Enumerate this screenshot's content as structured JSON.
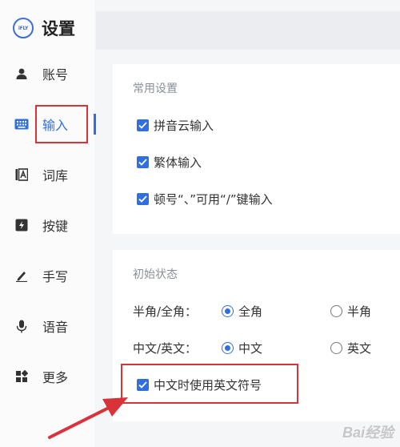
{
  "app": {
    "logo_text": "iFLY",
    "title": "设置"
  },
  "sidebar": {
    "items": [
      {
        "label": "账号",
        "icon": "user-icon"
      },
      {
        "label": "输入",
        "icon": "keyboard-icon",
        "active": true
      },
      {
        "label": "词库",
        "icon": "dictionary-icon"
      },
      {
        "label": "按键",
        "icon": "key-icon"
      },
      {
        "label": "手写",
        "icon": "handwriting-icon"
      },
      {
        "label": "语音",
        "icon": "microphone-icon"
      },
      {
        "label": "更多",
        "icon": "more-grid-icon"
      }
    ]
  },
  "common_settings": {
    "title": "常用设置",
    "options": [
      {
        "label": "拼音云输入",
        "checked": true
      },
      {
        "label": "繁体输入",
        "checked": true
      },
      {
        "label": "顿号“、”可用“/”键输入",
        "checked": true
      }
    ]
  },
  "initial_state": {
    "title": "初始状态",
    "width_mode": {
      "label": "半角/全角：",
      "options": [
        "全角",
        "半角"
      ],
      "selected": "全角"
    },
    "language_mode": {
      "label": "中文/英文：",
      "options": [
        "中文",
        "英文"
      ],
      "selected": "中文"
    },
    "english_punct": {
      "label": "中文时使用英文符号",
      "checked": true
    }
  },
  "watermark": "Bai经验",
  "colors": {
    "accent": "#2f6fe0",
    "annotation": "#d9333a"
  }
}
